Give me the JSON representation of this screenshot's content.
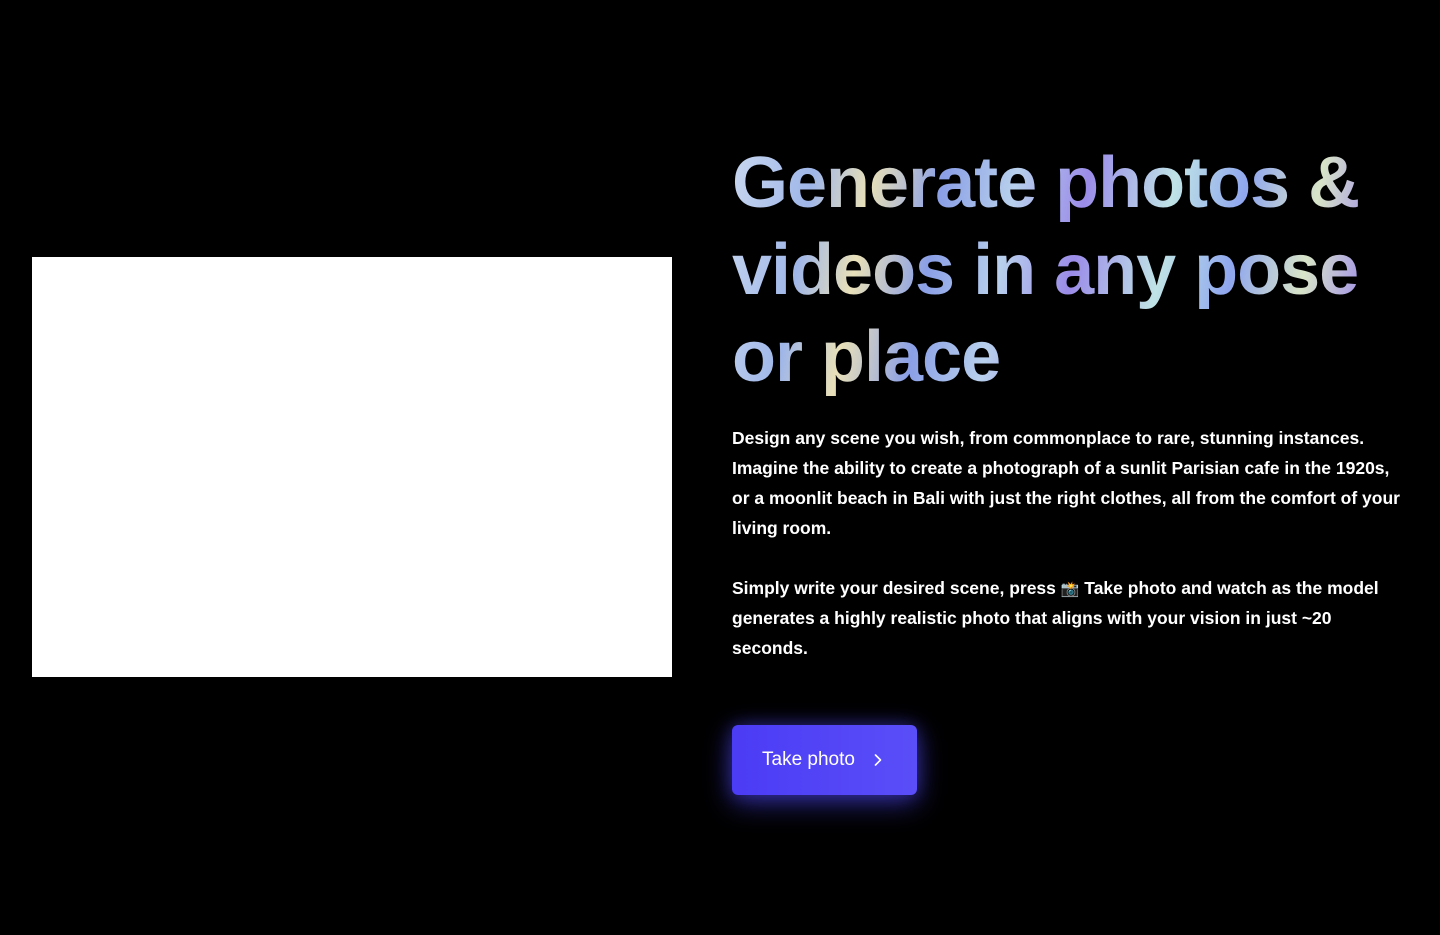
{
  "hero": {
    "headline_lines": [
      "Generate photos &",
      "videos in any pose",
      "or place"
    ],
    "description_1": "Design any scene you wish, from commonplace to rare, stunning instances. Imagine the ability to create a photograph of a sunlit Parisian cafe in the 1920s, or a moonlit beach in Bali with just the right clothes, all from the comfort of your living room.",
    "description_2_before": "Simply write your desired scene, press ",
    "description_2_emoji": "📸",
    "description_2_after": " Take photo and watch as the model generates a highly realistic photo that aligns with your vision in just ~20 seconds.",
    "cta_label": "Take photo",
    "cta_icon": "chevron-right-icon"
  },
  "colors": {
    "background": "#000000",
    "media_panel": "#ffffff",
    "cta_background": "#4b3cf5",
    "text": "#ffffff"
  }
}
